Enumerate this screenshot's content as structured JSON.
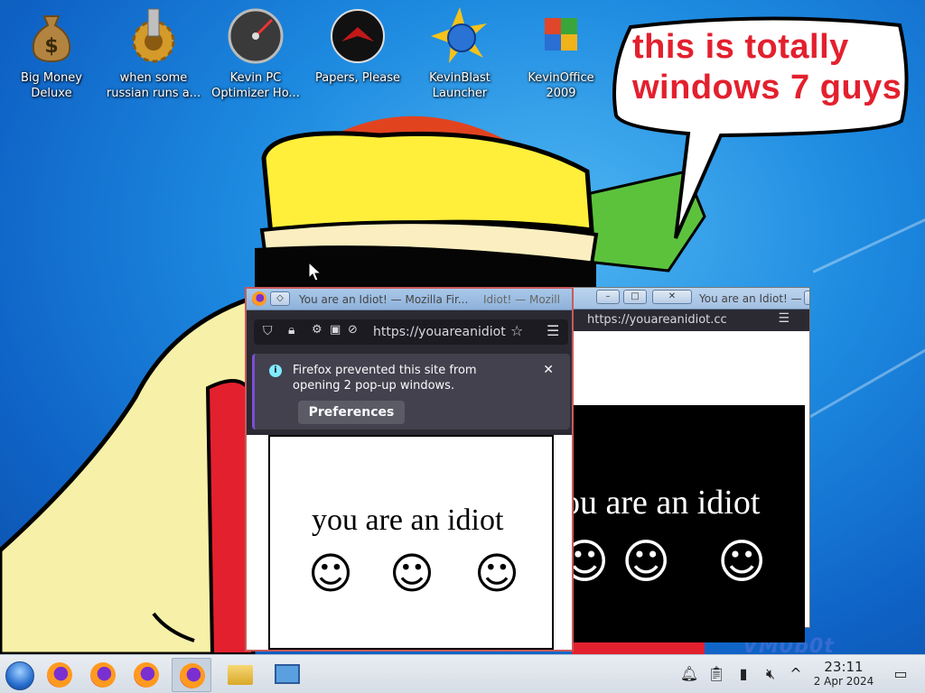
{
  "desktop": {
    "icons": [
      {
        "label": "Big Money Deluxe",
        "icon": "money-bag-icon"
      },
      {
        "label": "when some russian runs a...",
        "icon": "gear-icon"
      },
      {
        "label": "Kevin PC Optimizer Ho...",
        "icon": "speedometer-icon"
      },
      {
        "label": "Papers, Please",
        "icon": "emblem-icon"
      },
      {
        "label": "KevinBlast Launcher",
        "icon": "globe-burst-icon"
      },
      {
        "label": "KevinOffice 2009",
        "icon": "office-logo-icon"
      }
    ],
    "speech_bubble": "this is totally windows 7 guys",
    "watermark": "VM0b0t"
  },
  "window_back": {
    "title": "You are an Idiot! — Mozilla Fir...",
    "url": "https://youareanidiot.cc",
    "page_text": "you are an idiot"
  },
  "window_front": {
    "title": "You are an Idiot! — Mozilla Fir...",
    "tab_title_partial": "Idiot! — Mozill",
    "url": "https://youareanidiot",
    "notification": "Firefox prevented this site from opening 2 pop-up windows.",
    "preferences_button": "Preferences",
    "page_text": "you are an idiot"
  },
  "taskbar": {
    "time": "23:11",
    "date": "2 Apr 2024",
    "tray_icons": [
      "bell-icon",
      "clipboard-icon",
      "battery-icon",
      "mute-icon",
      "chevron-up-icon",
      "show-desktop-icon"
    ]
  },
  "colors": {
    "bubble_text": "#e3202e",
    "firefox_dark": "#2b2a33",
    "taskbar": "#d6dde6"
  }
}
